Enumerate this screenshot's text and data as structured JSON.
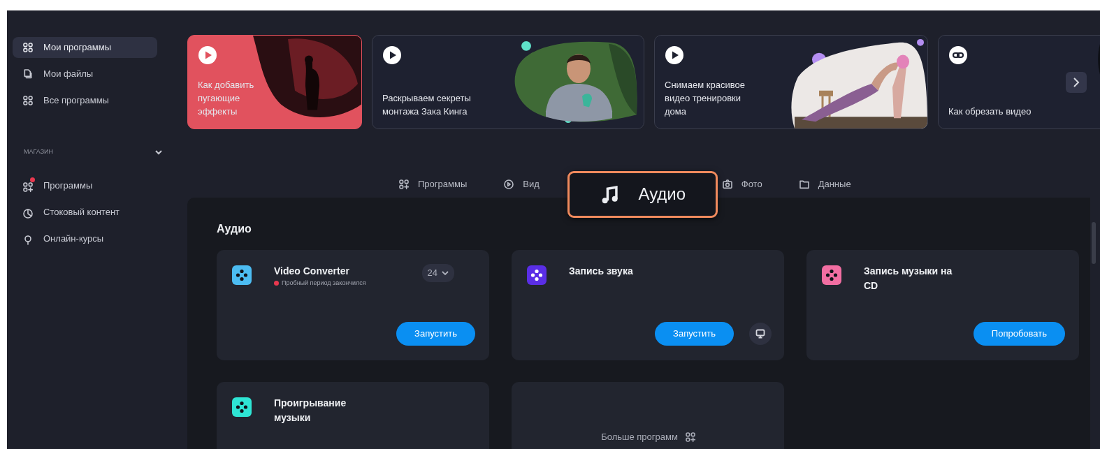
{
  "sidebar": {
    "items": [
      {
        "label": "Мои программы",
        "kind": "grid",
        "selected": true
      },
      {
        "label": "Мои файлы",
        "kind": "files",
        "selected": false
      },
      {
        "label": "Все программы",
        "kind": "grid",
        "selected": false
      }
    ],
    "section": {
      "title": "МАГАЗИН",
      "expanded": true
    },
    "store_items": [
      {
        "label": "Программы",
        "kind": "grid-plus",
        "notification": true
      },
      {
        "label": "Стоковый контент",
        "kind": "pie",
        "notification": false
      },
      {
        "label": "Онлайн-курсы",
        "kind": "bulb",
        "notification": false
      }
    ]
  },
  "banners": [
    {
      "title": "Как добавить пугающие эффекты",
      "kind": "video",
      "featured": true
    },
    {
      "title": "Раскрываем секреты монтажа Зака Кинга",
      "kind": "video",
      "featured": false
    },
    {
      "title": "Снимаем красивое видео тренировки дома",
      "kind": "video",
      "featured": false
    },
    {
      "title": "Как обрезать видео",
      "kind": "link",
      "featured": false
    }
  ],
  "tabs": [
    {
      "label": "Программы",
      "kind": "grid-plus",
      "selected": false
    },
    {
      "label": "Вид",
      "kind": "play",
      "selected": false
    },
    {
      "label": "Аудио",
      "kind": "note",
      "selected": true
    },
    {
      "label": "Фото",
      "kind": "camera",
      "selected": false
    },
    {
      "label": "Данные",
      "kind": "folder",
      "selected": false
    }
  ],
  "panel": {
    "title": "Аудио",
    "apps": [
      {
        "name": "Video Converter",
        "color": "#4cbcf2",
        "version": "24",
        "status": "Пробный период закончился",
        "action": "Запустить",
        "desktop": false
      },
      {
        "name": "Запись звука",
        "color": "#5a2ee6",
        "action": "Запустить",
        "desktop": true
      },
      {
        "name": "Запись музыки на CD",
        "color": "#f26ea2",
        "action": "Попробовать",
        "desktop": false
      },
      {
        "name": "Проигрывание музыки",
        "color": "#2ee5d4"
      }
    ],
    "more": {
      "label": "Больше программ"
    }
  }
}
